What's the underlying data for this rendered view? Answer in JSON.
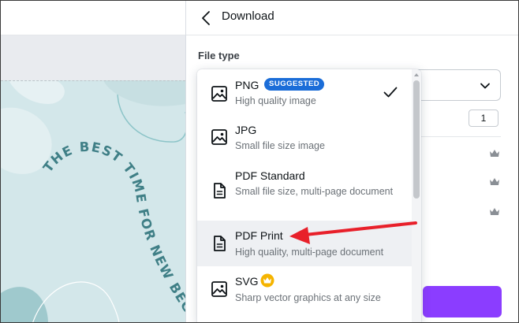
{
  "panel": {
    "title": "Download",
    "file_type_label": "File type",
    "size_value": "1"
  },
  "file_type_options": [
    {
      "name": "PNG",
      "badge": "SUGGESTED",
      "description": "High quality image",
      "icon": "image-icon",
      "selected": true
    },
    {
      "name": "JPG",
      "description": "Small file size image",
      "icon": "image-icon"
    },
    {
      "name": "PDF Standard",
      "description": "Small file size, multi-page document",
      "icon": "document-icon"
    },
    {
      "name": "PDF Print",
      "description": "High quality, multi-page document",
      "icon": "document-icon",
      "highlighted": true
    },
    {
      "name": "SVG",
      "description": "Sharp vector graphics at any size",
      "icon": "image-icon",
      "pro": true
    }
  ],
  "canvas": {
    "curved_text": "THE BEST TIME FOR NEW BEGINNINGS"
  },
  "colors": {
    "accent_purple": "#8b3dff",
    "badge_blue": "#1b6dd8",
    "annotation_red": "#e8202a",
    "canvas_text_teal": "#3f7f86",
    "pro_gold": "#f5b400"
  }
}
